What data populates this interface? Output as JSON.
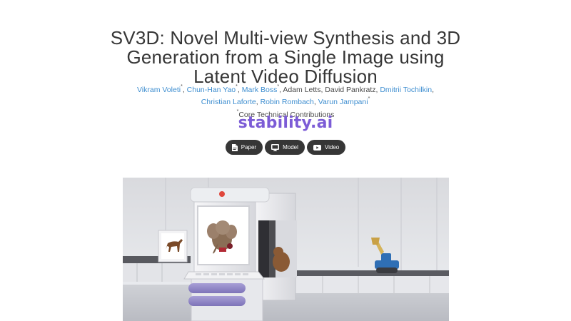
{
  "title": {
    "line1": "SV3D: Novel Multi-view Synthesis and 3D",
    "line2": "Generation from a Single Image using",
    "line3": "Latent Video Diffusion"
  },
  "authors": [
    {
      "name": "Vikram Voleti",
      "mark": "*",
      "link": true
    },
    {
      "name": "Chun-Han Yao",
      "mark": "*",
      "link": true
    },
    {
      "name": "Mark Boss",
      "mark": "*",
      "link": true
    },
    {
      "name": "Adam Letts",
      "mark": "",
      "link": false
    },
    {
      "name": "David Pankratz",
      "mark": "",
      "link": false
    },
    {
      "name": "Dmitrii Tochilkin",
      "mark": "",
      "link": true
    },
    {
      "name": "Christian Laforte",
      "mark": "",
      "link": true
    },
    {
      "name": "Robin Rombach",
      "mark": "",
      "link": true
    },
    {
      "name": "Varun Jampani",
      "mark": "*",
      "link": true
    }
  ],
  "note": {
    "mark": "*",
    "text": "Core Technical Contributions"
  },
  "brand": {
    "main": "stability",
    "dot": ".",
    "suffix": "ai"
  },
  "buttons": {
    "paper": {
      "label": "Paper",
      "icon": "file-pdf-icon"
    },
    "model": {
      "label": "Model",
      "icon": "monitor-icon"
    },
    "video": {
      "label": "Video",
      "icon": "youtube-icon"
    }
  },
  "colors": {
    "link": "#3e8ed0",
    "brand": "#7c5cd6",
    "button_bg": "#363636"
  }
}
